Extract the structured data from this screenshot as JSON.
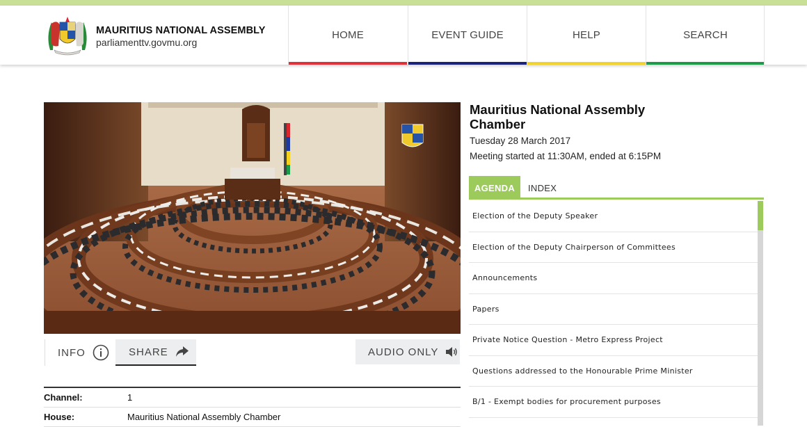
{
  "header": {
    "title": "MAURITIUS NATIONAL ASSEMBLY",
    "url": "parliamenttv.govmu.org",
    "nav": [
      {
        "label": "HOME",
        "color": "#e0313b"
      },
      {
        "label": "EVENT GUIDE",
        "color": "#1b237b"
      },
      {
        "label": "HELP",
        "color": "#f2d22e"
      },
      {
        "label": "SEARCH",
        "color": "#1e9b4a"
      }
    ]
  },
  "controls": {
    "info_label": "INFO",
    "share_label": "SHARE",
    "audio_label": "AUDIO ONLY"
  },
  "meta": [
    {
      "key": "Channel:",
      "value": "1"
    },
    {
      "key": "House:",
      "value": "Mauritius National Assembly Chamber"
    }
  ],
  "event": {
    "title": "Mauritius National Assembly Chamber",
    "date": "Tuesday 28 March 2017",
    "time": "Meeting started at 11:30AM, ended at 6:15PM"
  },
  "tabs": {
    "agenda": "AGENDA",
    "index": "INDEX"
  },
  "agenda": [
    "Election of the Deputy Speaker",
    "Election of the Deputy Chairperson of Committees",
    "Announcements",
    "Papers",
    "Private Notice Question - Metro Express Project",
    "Questions addressed to the Honourable Prime Minister",
    "B/1 - Exempt bodies for procurement purposes"
  ],
  "colors": {
    "accent_green": "#9ccb5c",
    "top_bar": "#c8df98"
  }
}
